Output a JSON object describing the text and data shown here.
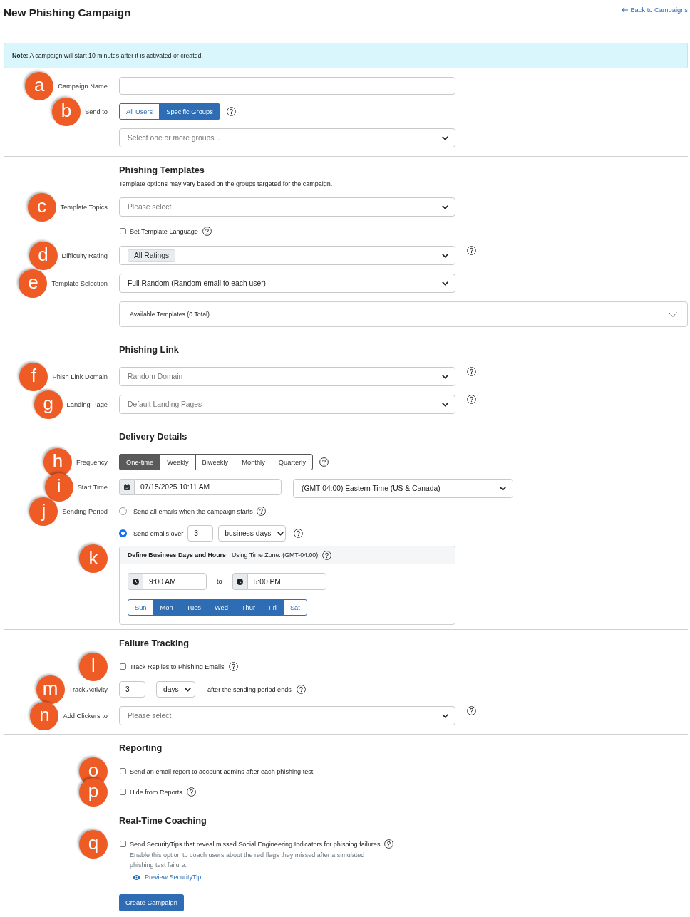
{
  "header": {
    "title": "New Phishing Campaign",
    "back_link": "Back to Campaigns"
  },
  "note": "**Note:** A campaign will start 10 minutes after it is activated or created.",
  "sections": [
    {
      "rows": [
        {
          "kind": "text_input",
          "marker": "a",
          "label": "Campaign Name"
        },
        {
          "kind": "toggle_group",
          "marker": "b",
          "label": "Send to",
          "help": true,
          "options": [
            {
              "label": "All Users",
              "selected": false
            },
            {
              "label": "Specific Groups",
              "selected": true
            }
          ]
        },
        {
          "kind": "select",
          "placeholder": "Select one or more groups..."
        }
      ]
    },
    {
      "title": "Phishing Templates",
      "subtitle": "Template options may vary based on the groups targeted for the campaign.",
      "rows": [
        {
          "kind": "select",
          "marker": "c",
          "label": "Template Topics",
          "placeholder": "Please select"
        },
        {
          "kind": "checkbox",
          "text": "Set Template Language",
          "checked": false,
          "help": true
        },
        {
          "kind": "select",
          "marker": "d",
          "label": "Difficulty Rating",
          "tags": [
            "All Ratings"
          ],
          "help": true
        },
        {
          "kind": "select",
          "marker": "e",
          "label": "Template Selection",
          "value": "Full Random (Random email to each user)"
        },
        {
          "kind": "collapsible",
          "text": "Available Templates (0 Total)",
          "expanded": false
        }
      ]
    },
    {
      "title": "Phishing Link",
      "rows": [
        {
          "kind": "select",
          "marker": "f",
          "label": "Phish Link Domain",
          "placeholder": "Random Domain",
          "help": true
        },
        {
          "kind": "select",
          "marker": "g",
          "label": "Landing Page",
          "placeholder": "Default Landing Pages",
          "help": true
        }
      ]
    },
    {
      "title": "Delivery Details",
      "rows": [
        {
          "kind": "segmented",
          "marker": "h",
          "label": "Frequency",
          "help": true,
          "options": [
            {
              "label": "One-time",
              "selected": true
            },
            {
              "label": "Weekly",
              "selected": false
            },
            {
              "label": "Biweekly",
              "selected": false
            },
            {
              "label": "Monthly",
              "selected": false
            },
            {
              "label": "Quarterly",
              "selected": false
            }
          ]
        },
        {
          "kind": "datetime",
          "marker": "i",
          "label": "Start Time",
          "value": "07/15/2025 10:11 AM",
          "timezone": "(GMT-04:00) Eastern Time (US & Canada)"
        },
        {
          "kind": "radio",
          "marker": "j",
          "label": "Sending Period",
          "text": "Send all emails when the campaign starts",
          "selected": false,
          "help": true
        },
        {
          "kind": "radio_duration",
          "text": "Send emails over",
          "selected": true,
          "value": "3",
          "unit": "business days",
          "help": true
        },
        {
          "kind": "hours_panel",
          "marker": "k",
          "title": "Define Business Days and Hours",
          "timezone_note": "Using Time Zone: (GMT-04:00)",
          "help": true,
          "start": "9:00 AM",
          "separator": "to",
          "end": "5:00 PM",
          "days": [
            {
              "label": "Sun",
              "selected": false
            },
            {
              "label": "Mon",
              "selected": true
            },
            {
              "label": "Tues",
              "selected": true
            },
            {
              "label": "Wed",
              "selected": true
            },
            {
              "label": "Thur",
              "selected": true
            },
            {
              "label": "Fri",
              "selected": true
            },
            {
              "label": "Sat",
              "selected": false
            }
          ]
        }
      ]
    },
    {
      "title": "Failure Tracking",
      "rows": [
        {
          "kind": "checkbox",
          "marker": "l",
          "text": "Track Replies to Phishing Emails",
          "checked": false,
          "help": true
        },
        {
          "kind": "duration",
          "marker": "m",
          "label": "Track Activity",
          "value": "3",
          "unit": "days",
          "suffix": "after the sending period ends",
          "help": true
        },
        {
          "kind": "select",
          "marker": "n",
          "label": "Add Clickers to",
          "placeholder": "Please select",
          "help": true
        }
      ]
    },
    {
      "title": "Reporting",
      "rows": [
        {
          "kind": "checkbox",
          "marker": "o",
          "text": "Send an email report to account admins after each phishing test",
          "checked": false
        },
        {
          "kind": "checkbox",
          "marker": "p",
          "text": "Hide from Reports",
          "checked": false,
          "help": true
        }
      ]
    },
    {
      "title": "Real-Time Coaching",
      "rows": [
        {
          "kind": "checkbox",
          "marker": "q",
          "text": "Send SecurityTips that reveal missed Social Engineering Indicators for phishing failures",
          "checked": false,
          "help": true,
          "description": "Enable this option to coach users about the red flags they missed after a simulated phishing test failure.",
          "link": "Preview SecurityTip"
        }
      ]
    }
  ],
  "submit_button": "Create Campaign"
}
